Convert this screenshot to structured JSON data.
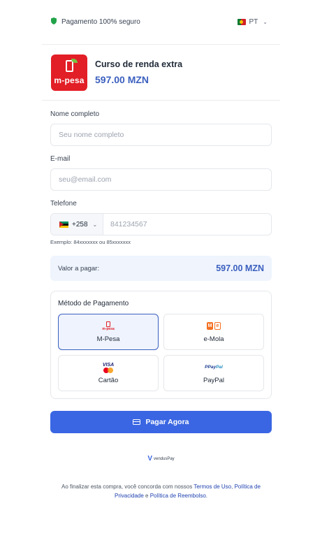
{
  "header": {
    "secure_text": "Pagamento 100% seguro",
    "language": "PT"
  },
  "product": {
    "logo_text": "m-pesa",
    "title": "Curso de renda extra",
    "price": "597.00 MZN"
  },
  "form": {
    "name_label": "Nome completo",
    "name_placeholder": "Seu nome completo",
    "email_label": "E-mail",
    "email_placeholder": "seu@email.com",
    "phone_label": "Telefone",
    "country_code": "+258",
    "phone_placeholder": "841234567",
    "phone_hint": "Exemplo: 84xxxxxxx ou 85xxxxxxx"
  },
  "amount": {
    "label": "Valor a pagar:",
    "value": "597.00 MZN"
  },
  "payment": {
    "title": "Método de Pagamento",
    "methods": [
      {
        "name": "M-Pesa",
        "icon": "mpesa-icon",
        "selected": true
      },
      {
        "name": "e-Mola",
        "icon": "emola-icon",
        "selected": false
      },
      {
        "name": "Cartão",
        "icon": "card-brands-icon",
        "selected": false
      },
      {
        "name": "PayPal",
        "icon": "paypal-icon",
        "selected": false
      }
    ]
  },
  "pay_button": "Pagar Agora",
  "powered_by": "vendusPay",
  "terms": {
    "prefix": "Ao finalizar esta compra, você concorda com nossos ",
    "terms_link": "Termos de Uso",
    "sep1": ", ",
    "privacy_link": "Política de Privacidade",
    "sep2": " e ",
    "refund_link": "Política de Reembolso",
    "suffix": "."
  },
  "colors": {
    "accent": "#3a66e3",
    "price": "#3b5fbf",
    "brand_red": "#e21e26",
    "secure_green": "#22a34a"
  }
}
